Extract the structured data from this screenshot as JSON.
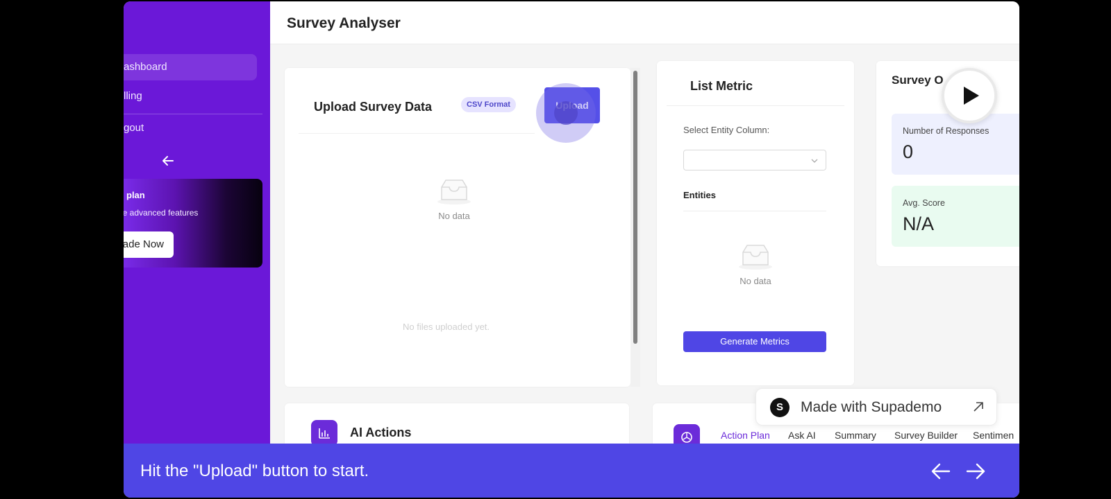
{
  "sidebar": {
    "items": [
      {
        "label": "ashboard"
      },
      {
        "label": "lling"
      },
      {
        "label": "gout"
      }
    ],
    "upgrade": {
      "title": "plan",
      "text": "ore advanced features",
      "button": "ade Now"
    }
  },
  "header": {
    "title": "Survey Analyser"
  },
  "upload": {
    "title": "Upload Survey Data",
    "tag": "CSV Format",
    "button": "Upload",
    "empty": "No data",
    "no_files": "No files uploaded yet."
  },
  "metric": {
    "title": "List Metric",
    "select_label": "Select Entity Column:",
    "entities_label": "Entities",
    "empty": "No data",
    "button": "Generate Metrics"
  },
  "overview": {
    "title": "Survey O",
    "stats": [
      {
        "label": "Number of Responses",
        "value": "0",
        "color": "#eef0fe"
      },
      {
        "label": "Avg. Score",
        "value": "N/A",
        "color": "#e9fbf0"
      }
    ]
  },
  "ai_actions": {
    "title": "AI Actions"
  },
  "tabs": [
    {
      "label": "Action Plan"
    },
    {
      "label": "Ask AI"
    },
    {
      "label": "Summary"
    },
    {
      "label": "Survey Builder"
    },
    {
      "label": "Sentimen"
    }
  ],
  "supademo": {
    "logo": "S",
    "label": "Made with Supademo"
  },
  "caption": {
    "text": "Hit the \"Upload\" button to start."
  },
  "colors": {
    "sidebar": "#6b18d8",
    "accent": "#4f46e5"
  }
}
